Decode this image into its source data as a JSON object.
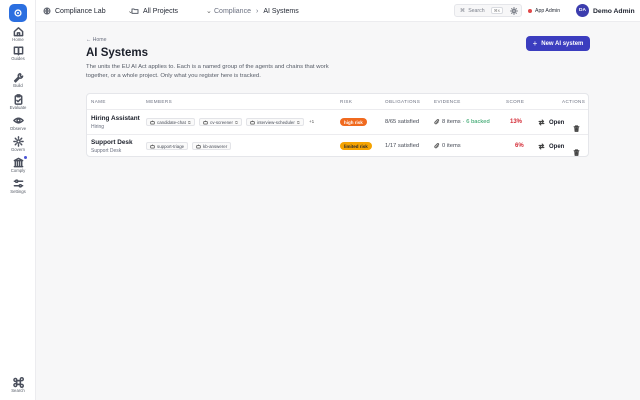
{
  "sidebar": {
    "items": [
      {
        "label": "Home",
        "icon": "home-icon"
      },
      {
        "label": "Guides",
        "icon": "book-icon"
      },
      {
        "label": "Build",
        "icon": "wrench-icon"
      },
      {
        "label": "Evaluate",
        "icon": "clipboard-icon"
      },
      {
        "label": "Observe",
        "icon": "eye-icon"
      },
      {
        "label": "Govern",
        "icon": "gear-icon"
      },
      {
        "label": "Comply",
        "icon": "building-icon"
      },
      {
        "label": "Settings",
        "icon": "sliders-icon"
      }
    ],
    "search_label": "Search"
  },
  "topbar": {
    "org": "Compliance Lab",
    "project": "All Projects",
    "breadcrumb": [
      "Compliance",
      "AI Systems"
    ],
    "search_label": "Search",
    "search_kbd": "⌘K",
    "admin_label": "App Admin",
    "avatar_initials": "DA",
    "user_name": "Demo Admin"
  },
  "page": {
    "back_label": "Home",
    "title": "AI Systems",
    "subtitle": "The units the EU AI Act applies to. Each is a named group of the agents and chains that work together, or a whole project. Only what you register here is tracked.",
    "new_button": "New AI system"
  },
  "table": {
    "headers": [
      "NAME",
      "MEMBERS",
      "RISK",
      "OBLIGATIONS",
      "EVIDENCE",
      "SCORE",
      "ACTIONS"
    ],
    "rows": [
      {
        "name": "Hiring Assistant",
        "sub": "Hiring",
        "members": [
          "candidate-chat",
          "cv-screener",
          "interview-scheduler"
        ],
        "more": "+1",
        "risk": "high risk",
        "obligations": "8/65 satisfied",
        "evidence": "8 items",
        "evidence_backed": "· 6 backed",
        "score": "13%",
        "open_label": "Open"
      },
      {
        "name": "Support Desk",
        "sub": "Support Desk",
        "members": [
          "support-triage",
          "kb-answerer"
        ],
        "more": "",
        "risk": "limited risk",
        "obligations": "1/17 satisfied",
        "evidence": "0 items",
        "evidence_backed": "",
        "score": "6%",
        "open_label": "Open"
      }
    ]
  },
  "colors": {
    "accent": "#3b3dbf",
    "high_risk": "#f06a1f",
    "limited_risk": "#f5a300",
    "score": "#d42a35",
    "backed": "#1e9a5a"
  }
}
